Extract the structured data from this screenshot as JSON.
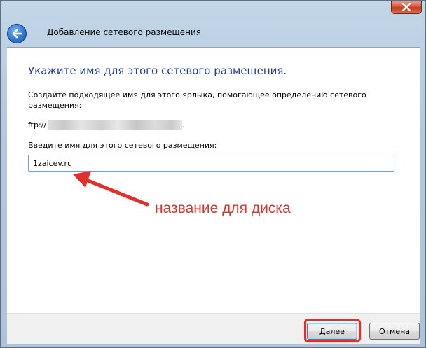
{
  "window": {
    "title": "Добавление сетевого размещения"
  },
  "wizard": {
    "heading": "Укажите имя для этого сетевого размещения.",
    "description": "Создайте подходящее имя для этого ярлыка, помогающее определению сетевого размещения:",
    "ftp_prefix": "ftp://",
    "ftp_suffix": ".",
    "name_label": "Введите имя для этого сетевого размещения:",
    "name_value": "1zaicev.ru"
  },
  "annotation": {
    "text": "название для диска",
    "color": "#e0302a"
  },
  "buttons": {
    "next_label": "Далее",
    "cancel_label": "Отмена"
  },
  "colors": {
    "heading": "#1e3d95",
    "close_button": "#c2391f",
    "back_button": "#2f78d6"
  },
  "icons": {
    "back": "back-arrow-icon",
    "close": "close-icon"
  }
}
